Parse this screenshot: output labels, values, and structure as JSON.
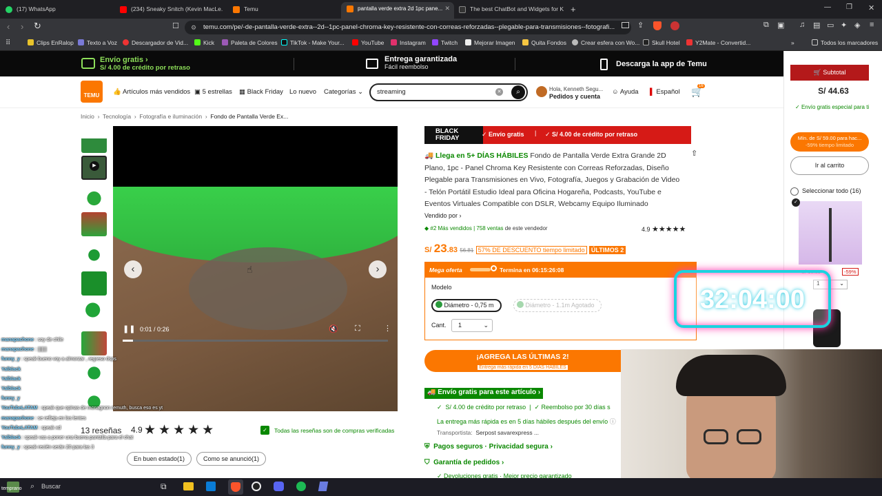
{
  "browser": {
    "tabs": [
      {
        "label": "(17) WhatsApp"
      },
      {
        "label": "(234) Sneaky Snitch (Kevin MacLe..."
      },
      {
        "label": "Temu"
      },
      {
        "label": "pantalla verde extra 2d 1pc pane..."
      },
      {
        "label": "The best ChatBot and Widgets for Ki..."
      }
    ],
    "url": "temu.com/pe/-de-pantalla-verde-extra--2d--1pc-panel-chroma-key-resistente-con-correas-reforzadas--plegable-para-transmisiones--fotografi...",
    "bookmarks": [
      "Clips EnRalop",
      "Texto a Voz",
      "Descargador de Vid...",
      "Kick",
      "Paleta de Colores",
      "TikTok - Make Your...",
      "YouTube",
      "Instagram",
      "Twitch",
      "Mejorar Imagen",
      "Quita Fondos",
      "Crear esfera con Wo...",
      "Skull Hotel",
      "Y2Mate - Convertid...",
      "Todos los marcadores"
    ]
  },
  "promo": {
    "free_shipping_title": "Envío gratis",
    "free_shipping_sub": "S/ 4.00 de crédito por retraso",
    "guarantee_title": "Entrega garantizada",
    "guarantee_sub": "Fácil reembolso",
    "app_label": "Descarga la app de Temu"
  },
  "nav": {
    "logo": "TEMU",
    "items": [
      "Artículos más vendidos",
      "5 estrellas",
      "Black Friday",
      "Lo nuevo",
      "Categorías"
    ],
    "search_value": "streaming",
    "account_line1": "Hola, Kenneth Segu...",
    "account_line2": "Pedidos y cuenta",
    "help": "Ayuda",
    "language": "Español",
    "cart_count": "16"
  },
  "breadcrumb": [
    "Inicio",
    "Tecnología",
    "Fotografía e iluminación",
    "Fondo de Pantalla Verde Ex..."
  ],
  "video": {
    "time": "0:01 / 0:26",
    "progress": 0.04
  },
  "reviews": {
    "count_label": "13 reseñas",
    "rating": "4.9",
    "verified": "Todas las reseñas son de compras verificadas",
    "filters": [
      "En buen estado(1)",
      "Como se anunció(1)"
    ]
  },
  "product": {
    "banner_main": "BLACK FRIDAY",
    "banner_shipping": "Envío gratis",
    "banner_credit": "S/ 4.00 de crédito por retraso",
    "arrival": "Llega en 5+ DÍAS HÁBILES",
    "title": "Fondo de Pantalla Verde Extra Grande 2D Plano, 1pc - Panel Chroma Key Resistente con Correas Reforzadas, Diseño Plegable para Transmisiones en Vivo, Fotografía, Juegos y Grabación de Video - Telón Portátil Estudio Ideal para Oficina Hogareña, Podcasts, YouTube e Eventos Virtuales Compatible con DSLR, Webcamy Equipo Iluminado",
    "sold_by": "Vendido por",
    "rank": "#2 Más vendidos",
    "sales": "758 ventas",
    "seller_suffix": "de este vendedor",
    "seller_rating": "4.9",
    "currency": "S/",
    "price": "23",
    "price_cents": ".83",
    "old_price": "56.81",
    "discount": "57% DE DESCUENTO tiempo limitado",
    "last_units": "ÚLTIMOS 2",
    "mega_offer": "Mega oferta",
    "ends_in": "Termina en 06:15:26:08",
    "model_label": "Modelo",
    "model_selected": "Diámetro - 0,75 m",
    "model_other": "Diámetro - 1.1m Agotado",
    "qty_label": "Cant.",
    "qty_value": "1",
    "cta": "¡AGREGA LAS ÚLTIMAS 2!",
    "cta_sub": "Entrega más rápida en 5 DÍAS HÁBILES",
    "free_ship_item": "Envío gratis para este artículo",
    "credit_line": "S/ 4.00 de crédito por retraso",
    "refund_line": "Reembolso por 30 días s",
    "fast_delivery": "La entrega más rápida es en 5 días hábiles después del envío",
    "carrier_label": "Transportista:",
    "carriers": "Serpost  savarexpress ...",
    "secure": "Pagos seguros · Privacidad segura",
    "guarantee": "Garantía de pedidos",
    "returns": "Devoluciones gratis  ·  Mejor precio garantizado"
  },
  "cart": {
    "subtotal_label": "Subtotal",
    "subtotal_value": "S/ 44.63",
    "free_ship": "Envío gratis especial para ti",
    "min_label": "Mín. de S/ 59.00 para hac...",
    "min_sub": "-59% tiempo limitado",
    "go_cart": "Ir al carrito",
    "select_all": "Seleccionar todo (16)",
    "item_old": "S/ 16.39",
    "item_discount": "-59%",
    "item_qty": "1"
  },
  "overlay": {
    "timer": "32:04:00"
  },
  "chat": [
    {
      "user": "manapachone",
      "msg": "soy de chile"
    },
    {
      "user": "manapachone",
      "msg": "|||||||"
    },
    {
      "user": "funny_y",
      "msg": "speak bueno voy a almorzar , regreso dsps"
    },
    {
      "user": "Yalblack",
      "msg": ""
    },
    {
      "user": "Yalblack",
      "msg": ""
    },
    {
      "user": "Yalblack",
      "msg": ""
    },
    {
      "user": "funny_y",
      "msg": ""
    },
    {
      "user": "YouTubeLATAM",
      "msg": "speak que opinas de monagnon remuth, busca eso es yt"
    },
    {
      "user": "manapachone",
      "msg": "se refleja en los lentes"
    },
    {
      "user": "YouTubeLATAM",
      "msg": "speak xd"
    },
    {
      "user": "Yalblack",
      "msg": "speak vas a poner una buena pantalla para el chat"
    },
    {
      "user": "funny_y",
      "msg": "speak recién serán 20 para las 3"
    }
  ],
  "taskbar": {
    "search": "Buscar",
    "weather": "temprano"
  },
  "colors": {
    "temu_orange": "#fb7701",
    "free_green": "#0a8800",
    "black_friday_red": "#d61a16"
  }
}
